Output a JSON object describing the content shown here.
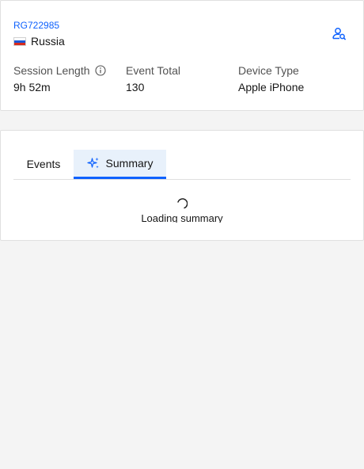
{
  "session": {
    "id": "RG722985",
    "country": "Russia"
  },
  "stats": [
    {
      "label": "Session Length",
      "value": "9h 52m"
    },
    {
      "label": "Event Total",
      "value": "130"
    },
    {
      "label": "Device Type",
      "value": "Apple iPhone"
    }
  ],
  "tabs": [
    {
      "label": "Events",
      "active": false
    },
    {
      "label": "Summary",
      "active": true
    }
  ],
  "summary": {
    "loading_text": "Loading summary"
  },
  "colors": {
    "accent": "#0f62fe",
    "active_tab_bg": "#e8f1fb",
    "page_bg": "#f4f4f4"
  }
}
